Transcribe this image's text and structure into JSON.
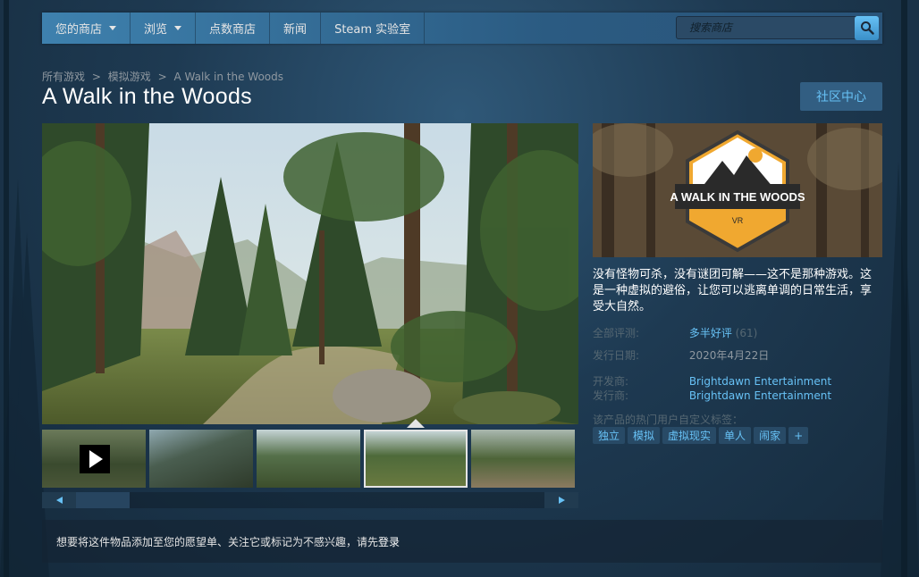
{
  "nav": {
    "items": [
      {
        "label": "您的商店",
        "dropdown": true
      },
      {
        "label": "浏览",
        "dropdown": true
      },
      {
        "label": "点数商店",
        "dropdown": false
      },
      {
        "label": "新闻",
        "dropdown": false
      },
      {
        "label": "Steam 实验室",
        "dropdown": false
      }
    ],
    "search_placeholder": "搜索商店"
  },
  "breadcrumb": [
    "所有游戏",
    "模拟游戏",
    "A Walk in the Woods"
  ],
  "breadcrumb_sep": ">",
  "title": "A Walk in the Woods",
  "community_button": "社区中心",
  "capsule": {
    "logo_text": "A WALK IN THE WOODS",
    "badge": "VR"
  },
  "description": "没有怪物可杀，没有谜团可解——这不是那种游戏。这是一种虚拟的避俗，让您可以逃离单调的日常生活，享受大自然。",
  "info": {
    "reviews_label": "全部评测:",
    "reviews_value": "多半好评",
    "reviews_count": "(61)",
    "release_label": "发行日期:",
    "release_value": "2020年4月22日",
    "developer_label": "开发商:",
    "developer_value": "Brightdawn Entertainment",
    "publisher_label": "发行商:",
    "publisher_value": "Brightdawn Entertainment"
  },
  "tags_label": "该产品的热门用户自定义标签：",
  "tags": [
    "独立",
    "模拟",
    "虚拟现实",
    "单人",
    "闹家",
    "+"
  ],
  "notice": {
    "text": "想要将这件物品添加至您的愿望单、关注它或标记为不感兴趣，请先",
    "login": "登录"
  },
  "colors": {
    "accent": "#67c1f5",
    "nav": "#3e81ae",
    "background": "#1e3a52",
    "logo_orange": "#f0a830"
  }
}
